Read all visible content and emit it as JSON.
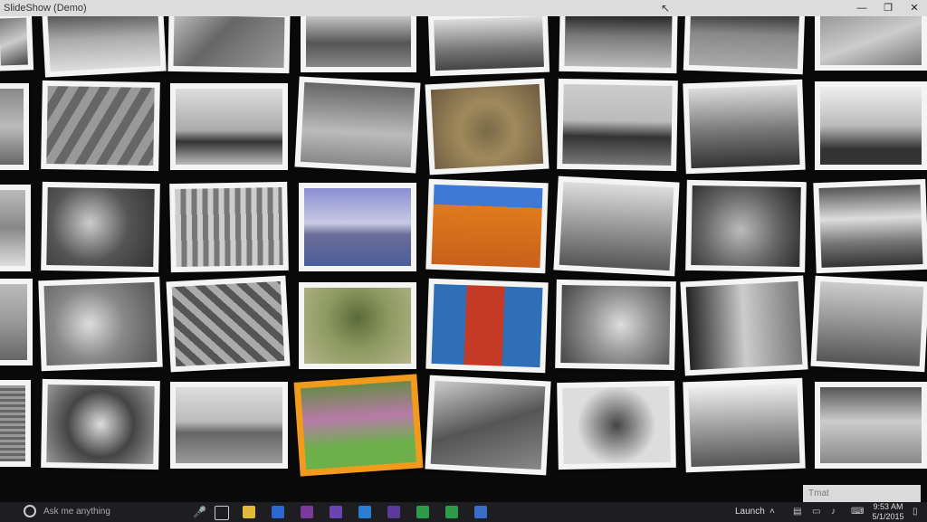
{
  "window": {
    "title": "SlideShow (Demo)",
    "minimize_glyph": "—",
    "maximize_glyph": "❐",
    "close_glyph": "✕"
  },
  "notification": {
    "text": "Tmat"
  },
  "taskbar": {
    "search_placeholder": "Ask me anything",
    "launch_label": "Launch",
    "time": "9:53 AM",
    "date": "5/1/2015",
    "pinned_icons": [
      "task-view-icon",
      "file-explorer-icon",
      "outlook-icon",
      "onenote-icon",
      "visual-studio-icon",
      "windows-app-icon",
      "purple-app-icon",
      "green-app-icon-1",
      "green-app-icon-2",
      "blue-app-icon"
    ],
    "tray_icons": [
      "chevron-up-icon",
      "network-icon",
      "volume-icon",
      "action-center-icon",
      "keyboard-icon"
    ]
  },
  "photos": [
    {
      "name": "photo-r1c1",
      "img": "linear-gradient(160deg,#777,#ccc 50%,#444)"
    },
    {
      "name": "photo-r1c2",
      "img": "linear-gradient(180deg,#555,#aaa 45%,#ddd)"
    },
    {
      "name": "photo-r1c3",
      "img": "linear-gradient(135deg,#bbb,#666 40%,#999)"
    },
    {
      "name": "photo-r1c4",
      "img": "linear-gradient(180deg,#ccc,#555 55%,#888)"
    },
    {
      "name": "photo-r1c5",
      "img": "linear-gradient(180deg,#ddd,#777 60%,#444)"
    },
    {
      "name": "photo-r1c6",
      "img": "linear-gradient(180deg,#222,#777 40%,#bbb)"
    },
    {
      "name": "photo-r1c7",
      "img": "linear-gradient(180deg,#333,#888 40%,#aaa)"
    },
    {
      "name": "photo-r1c8",
      "img": "linear-gradient(160deg,#999,#ccc 50%,#777)"
    },
    {
      "name": "photo-r2c1",
      "img": "linear-gradient(180deg,#888,#bbb 50%,#666)"
    },
    {
      "name": "photo-r2c2",
      "img": "repeating-linear-gradient(120deg,#999 0 10px,#666 10px 20px)"
    },
    {
      "name": "photo-r2c3",
      "img": "linear-gradient(180deg,#ddd,#aaa 55%,#333 70%,#bbb)"
    },
    {
      "name": "photo-r2c4",
      "img": "linear-gradient(180deg,#666,#bbb 60%,#888)"
    },
    {
      "name": "photo-r2c5",
      "img": "radial-gradient(circle at 50% 55%,#7a6a4a,#a08a5c 40%,#6d5a40)"
    },
    {
      "name": "photo-r2c6",
      "img": "linear-gradient(180deg,#ccc,#bbb 45%,#333 65%,#777)"
    },
    {
      "name": "photo-r2c7",
      "img": "linear-gradient(180deg,#ddd,#777 55%,#333)"
    },
    {
      "name": "photo-r2c8",
      "img": "linear-gradient(180deg,#eee,#bbb 50%,#333 80%)"
    },
    {
      "name": "photo-r3c1",
      "img": "linear-gradient(180deg,#bbb,#888 50%,#ddd)"
    },
    {
      "name": "photo-r3c2",
      "img": "radial-gradient(circle at 40% 45%,#ccc,#555 50%,#333)"
    },
    {
      "name": "photo-r3c3",
      "img": "repeating-linear-gradient(90deg,#ccc 0 6px,#777 6px 12px)"
    },
    {
      "name": "photo-r3c4",
      "img": "linear-gradient(180deg,#8a8fd0,#c9c9e3 45%,#6b6c98 60%,#4a5f9a)"
    },
    {
      "name": "photo-r3c5",
      "img": "linear-gradient(180deg,#3d7ad8 0%,#3d7ad8 25%,#e07a1c 25%,#c9601a 100%)"
    },
    {
      "name": "photo-r3c6",
      "img": "linear-gradient(180deg,#ddd,#999 50%,#555)"
    },
    {
      "name": "photo-r3c7",
      "img": "radial-gradient(circle at 45% 55%,#bbb,#666 50%,#222)"
    },
    {
      "name": "photo-r3c8",
      "img": "linear-gradient(180deg,#555,#ddd 40%,#777 70%,#333)"
    },
    {
      "name": "photo-r4c1",
      "img": "linear-gradient(180deg,#bbb,#999 50%,#666)"
    },
    {
      "name": "photo-r4c2",
      "img": "radial-gradient(circle at 40% 50%,#ddd,#888 45%,#555)"
    },
    {
      "name": "photo-r4c3",
      "img": "repeating-linear-gradient(45deg,#555 0 8px,#aaa 8px 16px)"
    },
    {
      "name": "photo-r4c4",
      "img": "radial-gradient(circle at 50% 40%,#5c6a3a,#8d9a60 45%,#b4b48a)"
    },
    {
      "name": "photo-r4c5",
      "img": "linear-gradient(90deg,#2f6fb8 0 30%,#c43a25 30% 65%,#2f6fb8 65%)"
    },
    {
      "name": "photo-r4c6",
      "img": "radial-gradient(circle at 55% 50%,#ddd,#999 40%,#444)"
    },
    {
      "name": "photo-r4c7",
      "img": "linear-gradient(90deg,#222,#ccc 50%,#777)"
    },
    {
      "name": "photo-r4c8",
      "img": "linear-gradient(180deg,#ccc,#999 45%,#555)"
    },
    {
      "name": "photo-r5c1",
      "img": "repeating-linear-gradient(0deg,#666 0 3px,#999 3px 6px)"
    },
    {
      "name": "photo-r5c2",
      "img": "radial-gradient(circle at 50% 50%,#ddd,#444 50%,#999)"
    },
    {
      "name": "photo-r5c3",
      "img": "linear-gradient(180deg,#ddd,#bbb 45%,#666 60%,#999)"
    },
    {
      "name": "photo-r5c4",
      "img": "linear-gradient(180deg,#6a8a4a,#b77aa8 40%,#6cb04a 75%)",
      "selected": true
    },
    {
      "name": "photo-r5c5",
      "img": "linear-gradient(160deg,#ccc,#555 50%,#888)"
    },
    {
      "name": "photo-r5c6",
      "img": "radial-gradient(circle at 50% 50%,#444,#ddd 60%)"
    },
    {
      "name": "photo-r5c7",
      "img": "linear-gradient(180deg,#eee,#999 55%,#555)"
    },
    {
      "name": "photo-r5c8",
      "img": "linear-gradient(180deg,#555,#ccc 45%,#888)"
    }
  ]
}
